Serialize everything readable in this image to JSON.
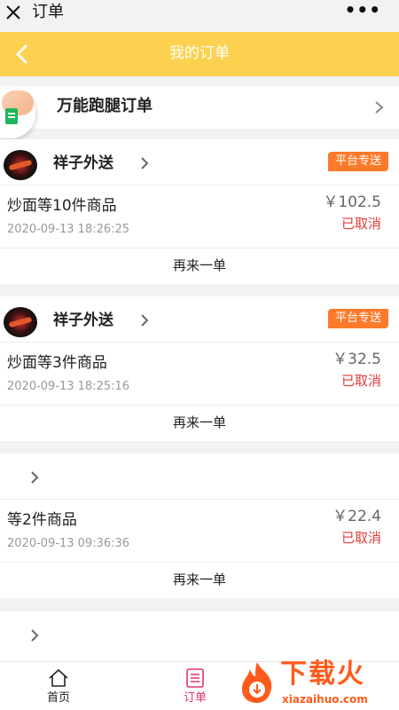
{
  "wechat_bar": {
    "title": "订单",
    "more": "•••"
  },
  "nav": {
    "title": "我的订单"
  },
  "banner": {
    "label": "万能跑腿订单"
  },
  "orders": [
    {
      "shop": "祥子外送",
      "badge": "平台专送",
      "goods": "炒面等10件商品",
      "time": "2020-09-13 18:26:25",
      "price": "￥102.5",
      "status": "已取消",
      "again": "再来一单"
    },
    {
      "shop": "祥子外送",
      "badge": "平台专送",
      "goods": "炒面等3件商品",
      "time": "2020-09-13 18:25:16",
      "price": "￥32.5",
      "status": "已取消",
      "again": "再来一单"
    },
    {
      "shop": "",
      "badge": "",
      "goods": "等2件商品",
      "time": "2020-09-13 09:36:36",
      "price": "￥22.4",
      "status": "已取消",
      "again": "再来一单"
    },
    {
      "shop": ""
    }
  ],
  "tabbar": {
    "home": {
      "label": "首页",
      "icon": "home-icon",
      "color": "#222222"
    },
    "orders": {
      "label": "订单",
      "icon": "order-list-icon",
      "color": "#e2356b"
    }
  },
  "watermark": {
    "title": "下载火",
    "url": "xiazaihuo.com",
    "color": "#ff5a1a"
  },
  "colors": {
    "nav": "#fcd14f",
    "badge": "#fb7a2b",
    "status": "#e33b3b",
    "active_tab": "#e2356b"
  }
}
